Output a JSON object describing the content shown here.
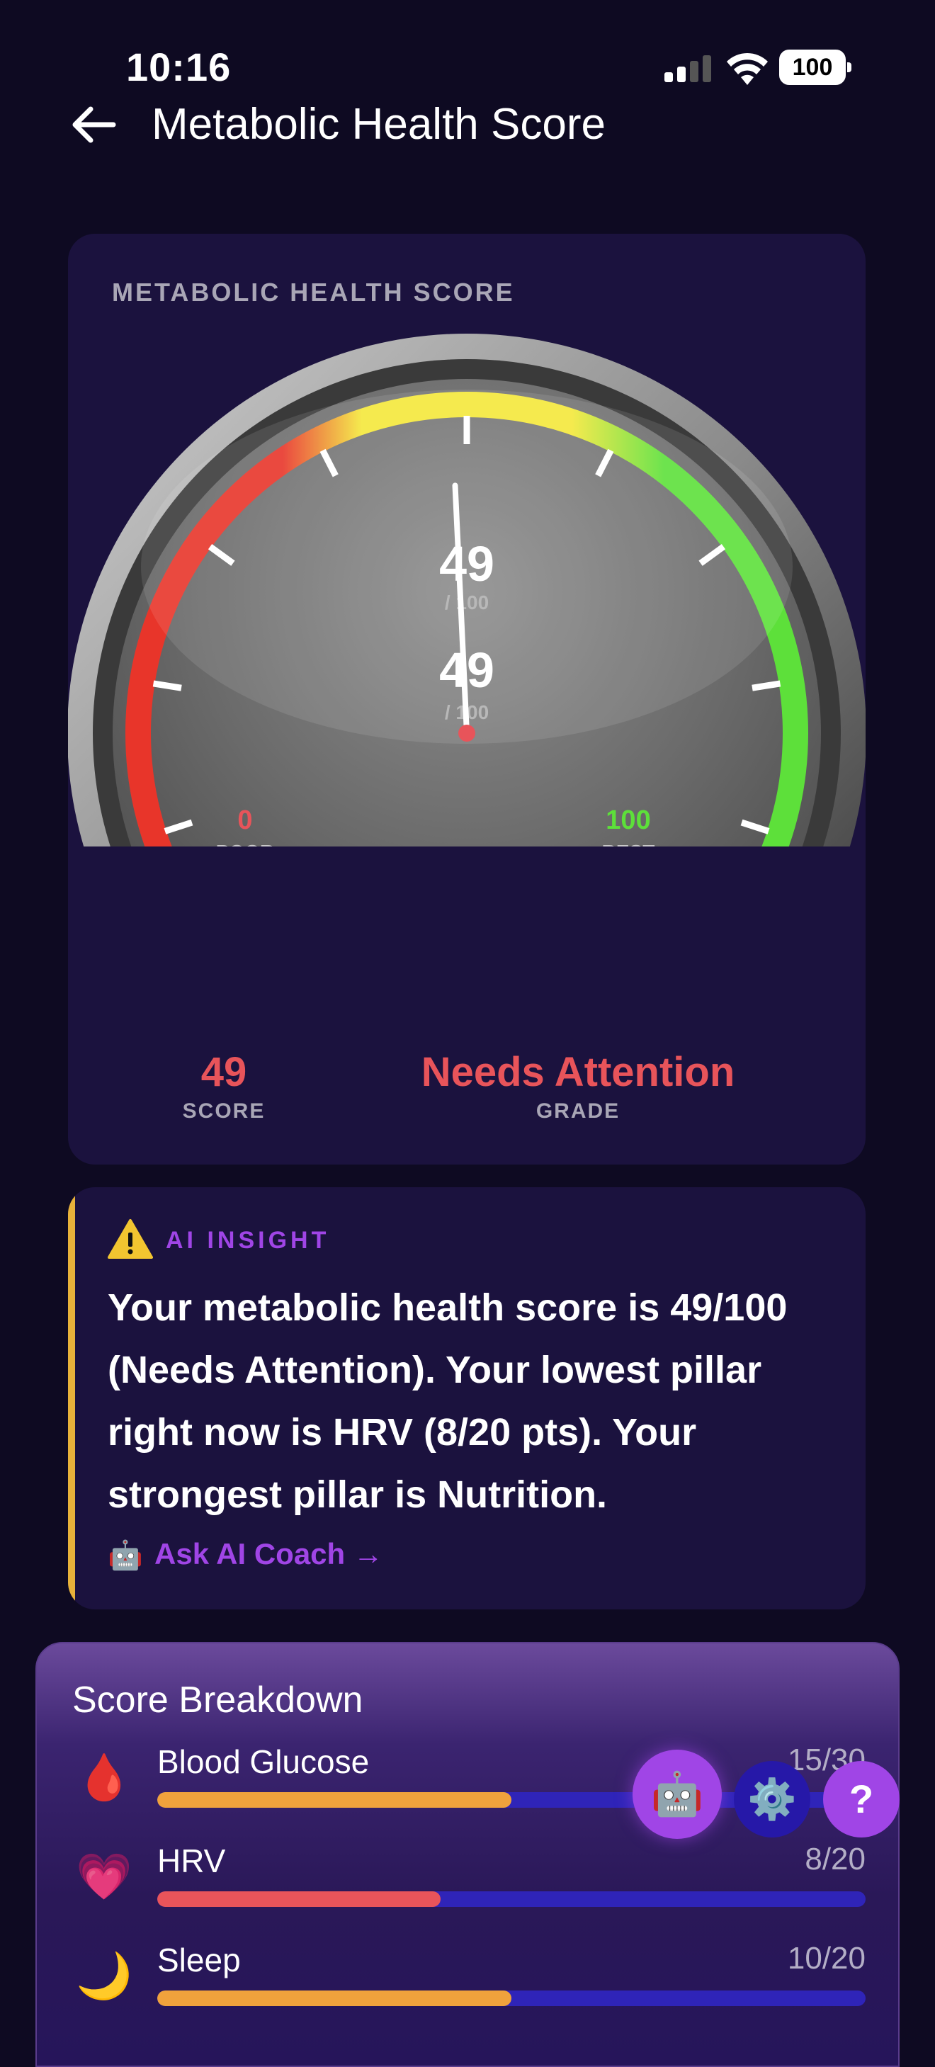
{
  "status_bar": {
    "time": "10:16",
    "battery": "100"
  },
  "nav": {
    "title": "Metabolic Health Score"
  },
  "gauge_card": {
    "label": "METABOLIC HEALTH SCORE",
    "score": 49,
    "readout_top": {
      "value": "49",
      "suffix": "/ 100"
    },
    "readout_bottom": {
      "value": "49",
      "suffix": "/ 100"
    },
    "min": {
      "value": "0",
      "label": "POOR"
    },
    "max": {
      "value": "100",
      "label": "BEST"
    },
    "colors": {
      "poor": "#e8352a",
      "mid": "#f4e83a",
      "good": "#5de03a"
    },
    "score_value": "49",
    "score_label": "SCORE",
    "grade_value": "Needs Attention",
    "grade_label": "GRADE"
  },
  "insight": {
    "label": "AI INSIGHT",
    "text": "Your metabolic health score is 49/100 (Needs Attention). Your lowest pillar right now is HRV (8/20 pts). Your strongest pillar is Nutrition.",
    "coach_icon": "🤖",
    "coach_link": "Ask AI Coach →"
  },
  "breakdown": {
    "title": "Score Breakdown",
    "items": [
      {
        "icon": "🩸",
        "name": "Blood Glucose",
        "value": "15/30",
        "fraction": 0.5,
        "color": "#f0a23c"
      },
      {
        "icon": "💗",
        "name": "HRV",
        "value": "8/20",
        "fraction": 0.4,
        "color": "#e8545a"
      },
      {
        "icon": "🌙",
        "name": "Sleep",
        "value": "10/20",
        "fraction": 0.5,
        "color": "#f0a23c"
      }
    ]
  },
  "fabs": {
    "ai": "🤖",
    "gear": "⚙️",
    "help": "?"
  }
}
